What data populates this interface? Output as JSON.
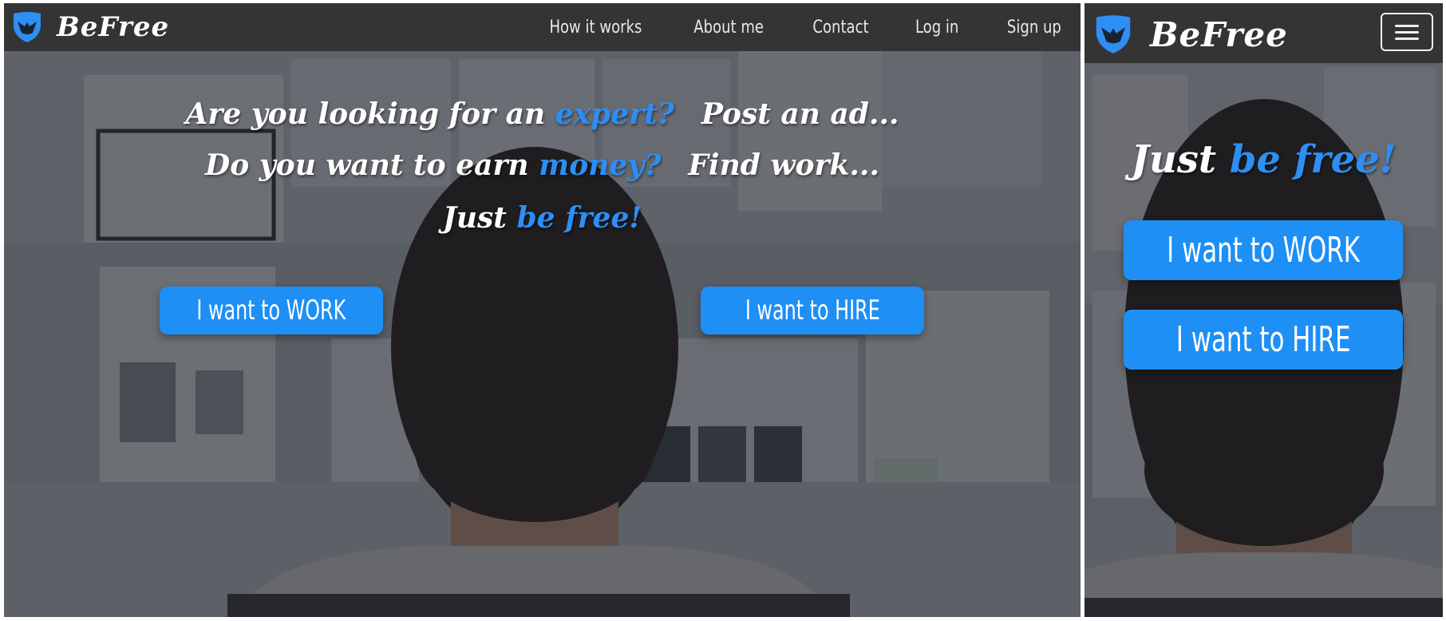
{
  "brand": {
    "name": "BeFree"
  },
  "nav": {
    "items": [
      {
        "label": "How it works"
      },
      {
        "label": "About me"
      },
      {
        "label": "Contact"
      },
      {
        "label": "Log in"
      },
      {
        "label": "Sign up"
      }
    ]
  },
  "hero": {
    "line1": {
      "q": "Are you looking for an",
      "q_accent": "expert?",
      "cta": "Post an ad..."
    },
    "line2": {
      "q": "Do you want to earn",
      "q_accent": "money?",
      "cta": "Find work..."
    },
    "tagline": {
      "prefix": "Just",
      "accent": "be free!"
    }
  },
  "buttons": {
    "work": "I want to WORK",
    "hire": "I want to HIRE"
  },
  "icons": {
    "logo": "bird-shield-icon",
    "menu": "hamburger-menu-icon"
  },
  "colors": {
    "navbar": "#343434",
    "accent": "#2d8ef3",
    "button": "#1e8ff5",
    "text": "#ffffff"
  }
}
